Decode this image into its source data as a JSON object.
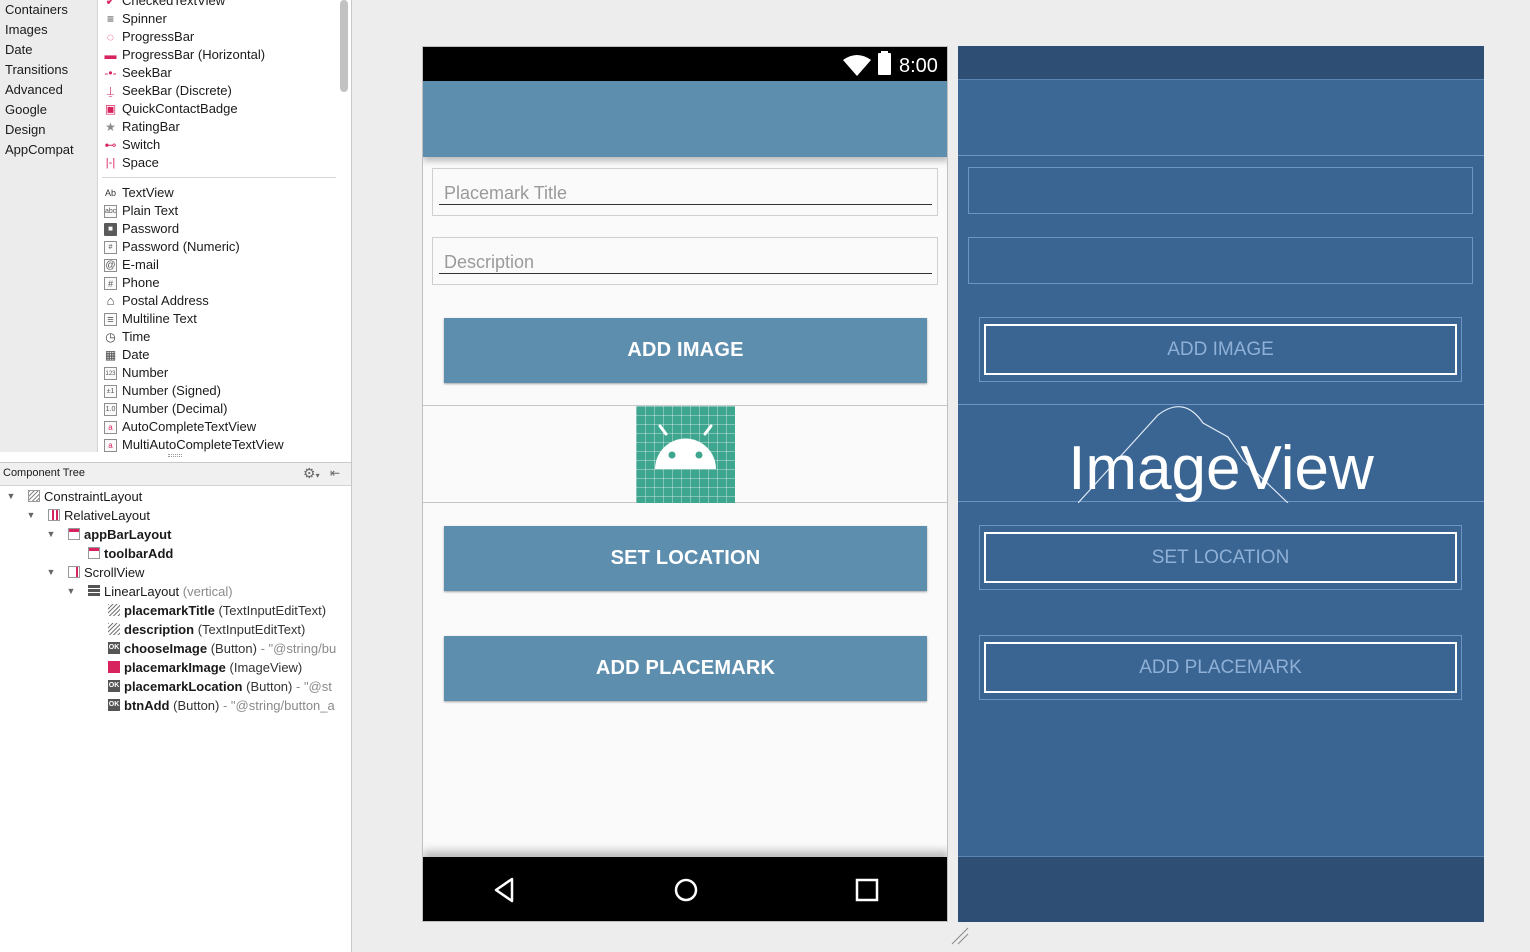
{
  "palette": {
    "categories": [
      "Containers",
      "Images",
      "Date",
      "Transitions",
      "Advanced",
      "Google",
      "Design",
      "AppCompat"
    ],
    "widgets_top": [
      {
        "label": "CheckedTextView",
        "icon": "checked-text-icon"
      },
      {
        "label": "Spinner",
        "icon": "spinner-icon"
      },
      {
        "label": "ProgressBar",
        "icon": "progress-circle-icon"
      },
      {
        "label": "ProgressBar (Horizontal)",
        "icon": "progress-horizontal-icon"
      },
      {
        "label": "SeekBar",
        "icon": "seekbar-icon"
      },
      {
        "label": "SeekBar (Discrete)",
        "icon": "seekbar-discrete-icon"
      },
      {
        "label": "QuickContactBadge",
        "icon": "contact-badge-icon"
      },
      {
        "label": "RatingBar",
        "icon": "star-icon"
      },
      {
        "label": "Switch",
        "icon": "switch-icon"
      },
      {
        "label": "Space",
        "icon": "space-icon"
      }
    ],
    "widgets_text": [
      {
        "label": "TextView",
        "glyph": "Ab"
      },
      {
        "label": "Plain Text",
        "glyph": "abc"
      },
      {
        "label": "Password",
        "glyph": "🔒"
      },
      {
        "label": "Password (Numeric)",
        "glyph": "#"
      },
      {
        "label": "E-mail",
        "glyph": "@"
      },
      {
        "label": "Phone",
        "glyph": "#"
      },
      {
        "label": "Postal Address",
        "glyph": "⌂"
      },
      {
        "label": "Multiline Text",
        "glyph": "≡"
      },
      {
        "label": "Time",
        "glyph": "◷"
      },
      {
        "label": "Date",
        "glyph": "▦"
      },
      {
        "label": "Number",
        "glyph": "123"
      },
      {
        "label": "Number (Signed)",
        "glyph": "±1"
      },
      {
        "label": "Number (Decimal)",
        "glyph": "1.0"
      },
      {
        "label": "AutoCompleteTextView",
        "glyph": "a"
      },
      {
        "label": "MultiAutoCompleteTextView",
        "glyph": "a"
      }
    ]
  },
  "component_tree": {
    "title": "Component Tree",
    "nodes": [
      {
        "level": 0,
        "arrow": "▼",
        "icon": "constraint",
        "name": "ConstraintLayout",
        "bold": false,
        "desc": "",
        "attr": ""
      },
      {
        "level": 1,
        "arrow": "▼",
        "icon": "relative",
        "name": "RelativeLayout",
        "bold": false,
        "desc": "",
        "attr": ""
      },
      {
        "level": 2,
        "arrow": "▼",
        "icon": "appbar",
        "name": "appBarLayout",
        "bold": true,
        "desc": "",
        "attr": ""
      },
      {
        "level": 3,
        "arrow": "",
        "icon": "appbar",
        "name": "toolbarAdd",
        "bold": true,
        "desc": "",
        "attr": ""
      },
      {
        "level": 2,
        "arrow": "▼",
        "icon": "scroll",
        "name": "ScrollView",
        "bold": false,
        "desc": "",
        "attr": ""
      },
      {
        "level": 3,
        "arrow": "▼",
        "icon": "linear",
        "name": "LinearLayout",
        "bold": false,
        "desc": "",
        "attr": "(vertical)"
      },
      {
        "level": 4,
        "arrow": "",
        "icon": "text",
        "name": "placemarkTitle",
        "bold": true,
        "desc": "(TextInputEditText)",
        "attr": ""
      },
      {
        "level": 4,
        "arrow": "",
        "icon": "text",
        "name": "description",
        "bold": true,
        "desc": "(TextInputEditText)",
        "attr": ""
      },
      {
        "level": 4,
        "arrow": "",
        "icon": "button",
        "name": "chooseImage",
        "bold": true,
        "desc": "(Button)",
        "attr": "- \"@string/bu"
      },
      {
        "level": 4,
        "arrow": "",
        "icon": "image",
        "name": "placemarkImage",
        "bold": true,
        "desc": "(ImageView)",
        "attr": ""
      },
      {
        "level": 4,
        "arrow": "",
        "icon": "button",
        "name": "placemarkLocation",
        "bold": true,
        "desc": "(Button)",
        "attr": "- \"@st"
      },
      {
        "level": 4,
        "arrow": "",
        "icon": "button",
        "name": "btnAdd",
        "bold": true,
        "desc": "(Button)",
        "attr": "- \"@string/button_a"
      }
    ]
  },
  "device": {
    "time": "8:00",
    "title_placeholder": "Placemark Title",
    "description_placeholder": "Description",
    "add_image": "ADD IMAGE",
    "set_location": "SET LOCATION",
    "add_placemark": "ADD PLACEMARK",
    "accent": "#5e8eae"
  },
  "blueprint": {
    "add_image": "ADD IMAGE",
    "image_label": "ImageView",
    "set_location": "SET LOCATION",
    "add_placemark": "ADD PLACEMARK",
    "background": "#3a6593"
  }
}
